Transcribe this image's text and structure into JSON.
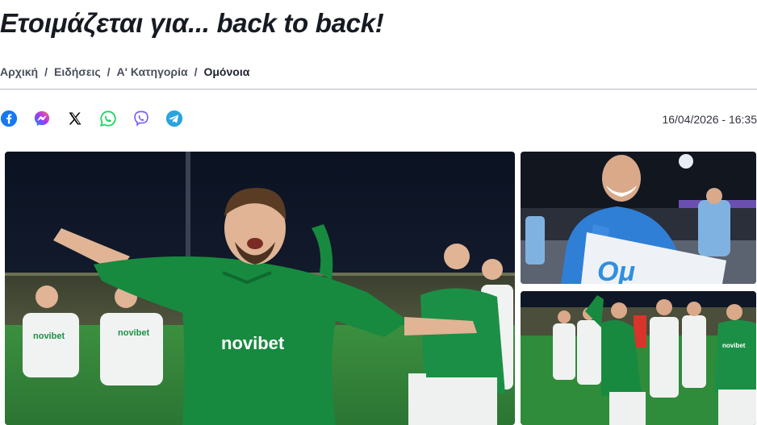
{
  "article": {
    "title": "Ετοιμάζεται για... back to back!",
    "datetime": "16/04/2026 - 16:35"
  },
  "breadcrumb": {
    "items": [
      {
        "label": "Αρχική"
      },
      {
        "label": "Ειδήσεις"
      },
      {
        "label": "Α' Κατηγορία"
      },
      {
        "label": "Ομόνοια"
      }
    ],
    "separator": "/"
  },
  "share": {
    "buttons": [
      {
        "icon": "facebook-icon",
        "color": "#1877f2"
      },
      {
        "icon": "messenger-icon",
        "color": "#a334fa"
      },
      {
        "icon": "x-icon",
        "color": "#000000"
      },
      {
        "icon": "whatsapp-icon",
        "color": "#25d366"
      },
      {
        "icon": "viber-icon",
        "color": "#7360f2"
      },
      {
        "icon": "telegram-icon",
        "color": "#2aa3df"
      }
    ]
  },
  "photos": {
    "main": {
      "jersey_text": "novibet",
      "sponsor_text": "novibet"
    },
    "side1": {
      "board_text": "Ομ"
    },
    "side2": {
      "sponsor_text": "novibet"
    }
  },
  "colors": {
    "jersey_green": "#178a3f",
    "sky": "#0d1424",
    "pitch": "#2f8c3a",
    "keeper_blue": "#2f7fd6"
  }
}
